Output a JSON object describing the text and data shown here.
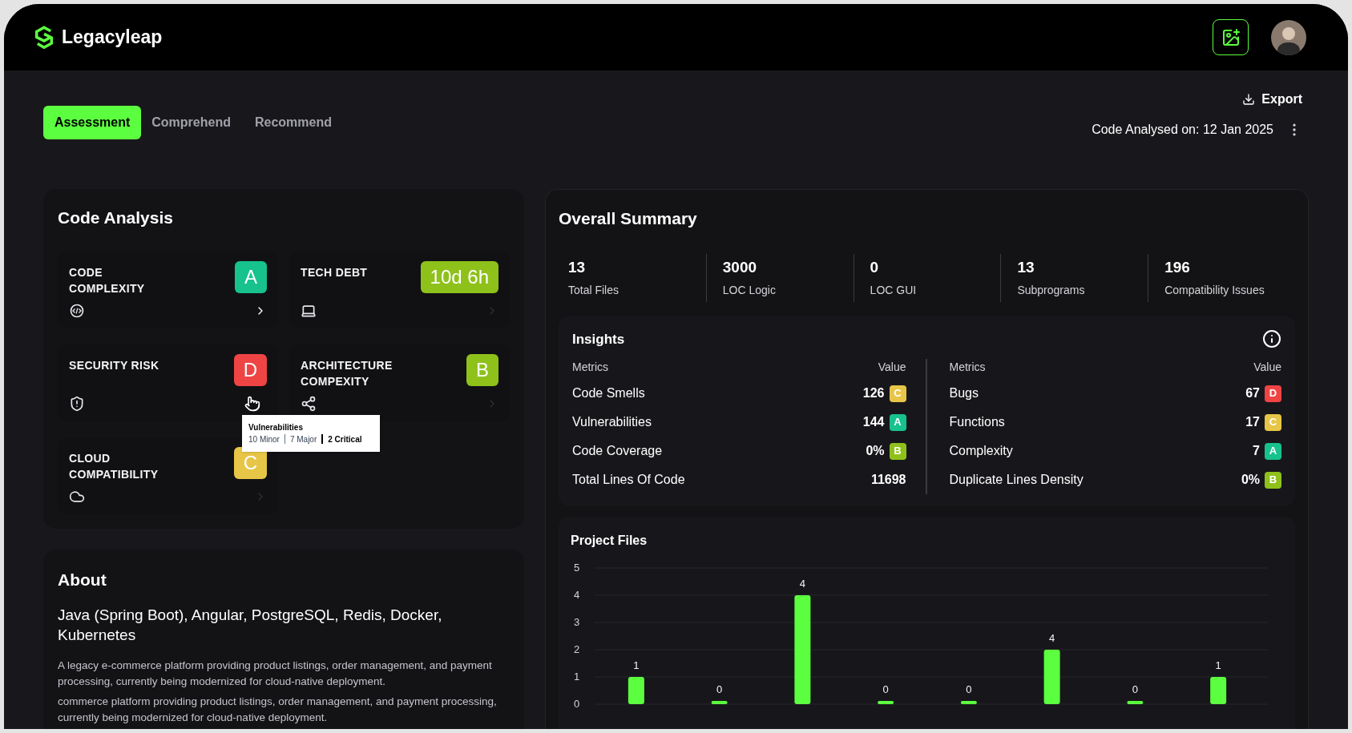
{
  "brand": {
    "name": "Legacyleap"
  },
  "tabs": [
    {
      "label": "Assessment",
      "selected": true
    },
    {
      "label": "Comprehend",
      "selected": false
    },
    {
      "label": "Recommend",
      "selected": false
    }
  ],
  "export": {
    "label": "Export"
  },
  "analysed": {
    "label": "Code Analysed on:",
    "date": "12 Jan 2025"
  },
  "code_analysis": {
    "title": "Code Analysis",
    "cards": [
      {
        "title": "CODE COMPLEXITY",
        "badge": "A",
        "color": "#17c28c",
        "kind": "code",
        "active": true,
        "hovered": false
      },
      {
        "title": "TECH DEBT",
        "badge": "10d 6h",
        "color": "#8fc11b",
        "kind": "laptop",
        "active": false,
        "hovered": false
      },
      {
        "title": "SECURITY RISK",
        "badge": "D",
        "color": "#ef4444",
        "kind": "shield",
        "hovered": true
      },
      {
        "title": "ARCHITECTURE COMPEXITY",
        "badge": "B",
        "color": "#8fc11b",
        "kind": "share",
        "active": false,
        "hovered": false
      },
      {
        "title": "CLOUD COMPATIBILITY",
        "badge": "C",
        "color": "#e7c547",
        "kind": "cloud",
        "active": false,
        "hovered": false
      }
    ],
    "tooltip": {
      "title": "Vulnerabilities",
      "parts": [
        {
          "text": "10 Minor",
          "emphasis": false
        },
        {
          "text": "7 Major",
          "emphasis": false
        },
        {
          "text": "2 Critical",
          "emphasis": true
        }
      ]
    }
  },
  "about": {
    "title": "About",
    "stack": "Java (Spring Boot), Angular, PostgreSQL, Redis, Docker, Kubernetes",
    "paragraphs": [
      "A legacy e-commerce platform providing product listings, order management, and payment processing, currently being modernized for cloud-native deployment.",
      "commerce platform providing product listings, order management, and payment processing, currently being modernized for cloud-native deployment."
    ]
  },
  "summary": {
    "title": "Overall Summary",
    "stats": [
      {
        "value": "13",
        "label": "Total Files"
      },
      {
        "value": "3000",
        "label": "LOC Logic"
      },
      {
        "value": "0",
        "label": "LOC GUI"
      },
      {
        "value": "13",
        "label": "Subprograms"
      },
      {
        "value": "196",
        "label": "Compatibility Issues"
      }
    ],
    "insights": {
      "title": "Insights",
      "columns": [
        {
          "metric_header": "Metrics",
          "value_header": "Value",
          "rows": [
            {
              "metric": "Code Smells",
              "value": "126",
              "grade": "C",
              "color": "#e7c547"
            },
            {
              "metric": "Vulnerabilities",
              "value": "144",
              "grade": "A",
              "color": "#17c28c"
            },
            {
              "metric": "Code Coverage",
              "value": "0%",
              "grade": "B",
              "color": "#8fc11b"
            },
            {
              "metric": "Total Lines Of Code",
              "value": "11698"
            }
          ]
        },
        {
          "metric_header": "Metrics",
          "value_header": "Value",
          "rows": [
            {
              "metric": "Bugs",
              "value": "67",
              "grade": "D",
              "color": "#ef4444"
            },
            {
              "metric": "Functions",
              "value": "17",
              "grade": "C",
              "color": "#e7c547"
            },
            {
              "metric": "Complexity",
              "value": "7",
              "grade": "A",
              "color": "#17c28c"
            },
            {
              "metric": "Duplicate Lines Density",
              "value": "0%",
              "grade": "B",
              "color": "#8fc11b"
            }
          ]
        }
      ]
    },
    "project_files": {
      "title": "Project Files",
      "chart_data": {
        "type": "bar",
        "ylim": [
          0,
          5
        ],
        "yticks": [
          0,
          1,
          2,
          3,
          4,
          5
        ],
        "grid": true,
        "series": [
          {
            "color": "#5cff3f",
            "values": [
              1,
              0,
              4,
              0,
              0,
              2,
              0,
              1
            ]
          }
        ],
        "value_labels": [
          "1",
          "0",
          "4",
          "0",
          "0",
          "4",
          "0",
          "1"
        ]
      }
    }
  }
}
